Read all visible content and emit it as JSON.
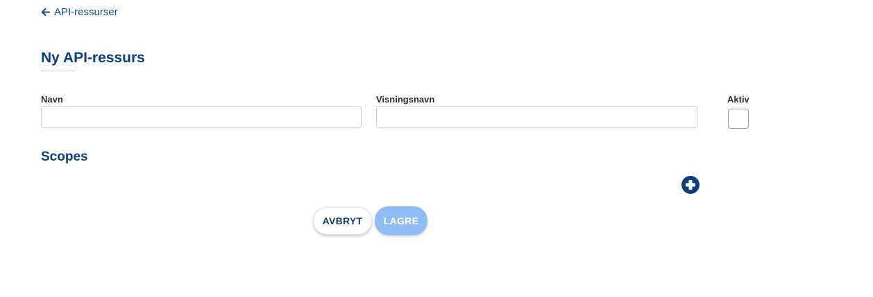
{
  "nav": {
    "back_label": "API-ressurser"
  },
  "page": {
    "title": "Ny API-ressurs"
  },
  "form": {
    "name_label": "Navn",
    "name_value": "",
    "display_name_label": "Visningsnavn",
    "display_name_value": "",
    "active_label": "Aktiv",
    "active_checked": false
  },
  "scopes": {
    "title": "Scopes",
    "add_icon": "plus-circle-icon"
  },
  "actions": {
    "cancel_label": "AVBRYT",
    "save_label": "LAGRE"
  },
  "colors": {
    "primary": "#0d3f7a",
    "link": "#0d4d8c",
    "save_disabled": "#8fbcf5"
  }
}
